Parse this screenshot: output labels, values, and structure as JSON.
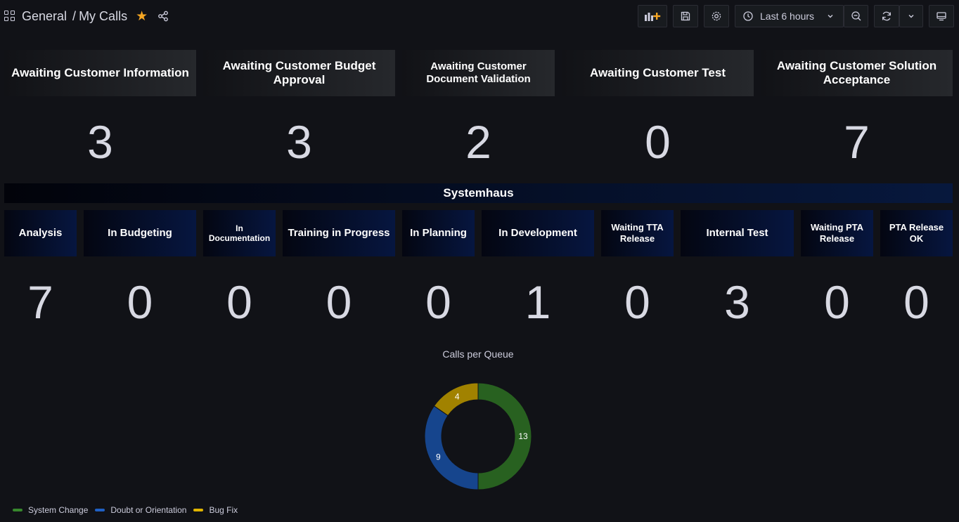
{
  "breadcrumb": {
    "folder": "General",
    "separator": "/",
    "title": "My Calls"
  },
  "toolbar": {
    "time_range": "Last 6 hours"
  },
  "top_panels": [
    {
      "label": "Awaiting Customer Information",
      "value": "3"
    },
    {
      "label": "Awaiting Customer Budget Approval",
      "value": "3"
    },
    {
      "label": "Awaiting Customer Document Validation",
      "value": "2"
    },
    {
      "label": "Awaiting Customer Test",
      "value": "0"
    },
    {
      "label": "Awaiting Customer Solution Acceptance",
      "value": "7"
    }
  ],
  "section": {
    "title": "Systemhaus"
  },
  "status_panels": [
    {
      "label": "Analysis",
      "value": "7"
    },
    {
      "label": "In Budgeting",
      "value": "0"
    },
    {
      "label": "In Documentation",
      "value": "0"
    },
    {
      "label": "Training in Progress",
      "value": "0"
    },
    {
      "label": "In Planning",
      "value": "0"
    },
    {
      "label": "In Development",
      "value": "1"
    },
    {
      "label": "Waiting TTA Release",
      "value": "0"
    },
    {
      "label": "Internal Test",
      "value": "3"
    },
    {
      "label": "Waiting PTA Release",
      "value": "0"
    },
    {
      "label": "PTA Release OK",
      "value": "0"
    }
  ],
  "colors": {
    "accent_star": "#f5a623",
    "system_change": "#37872d",
    "doubt_or_orientation": "#1f60c4",
    "bug_fix": "#e0b400"
  },
  "chart_data": {
    "type": "pie",
    "title": "Calls per Queue",
    "donut": true,
    "legend_position": "bottom-left",
    "slices": [
      {
        "name": "System Change",
        "value": 13,
        "color": "#37872d"
      },
      {
        "name": "Doubt or Orientation",
        "value": 9,
        "color": "#1f60c4"
      },
      {
        "name": "Bug Fix",
        "value": 4,
        "color": "#e0b400"
      }
    ]
  }
}
